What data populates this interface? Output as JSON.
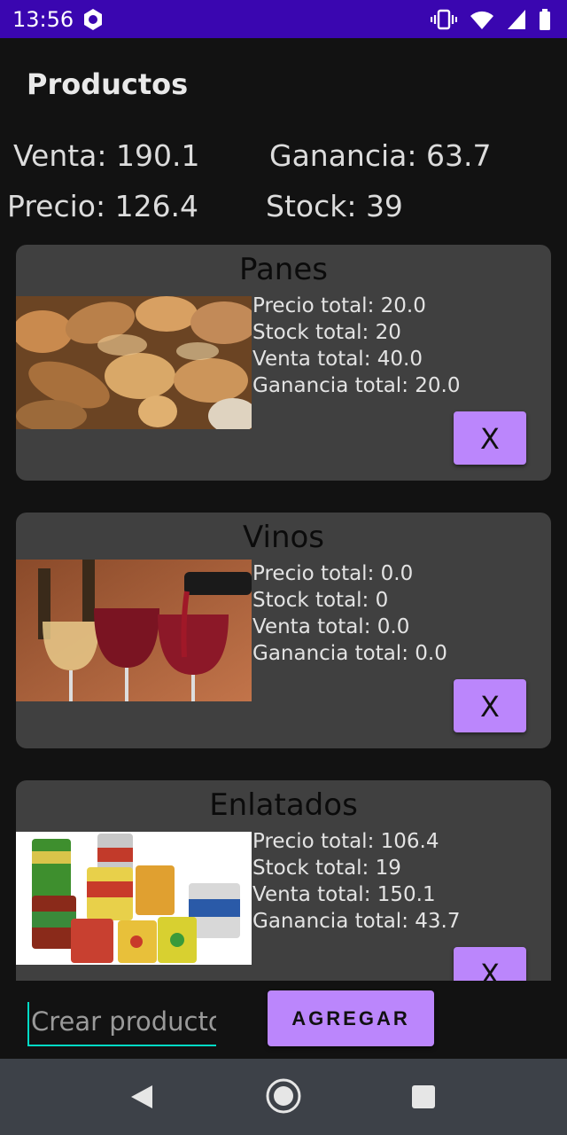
{
  "status_bar": {
    "time": "13:56",
    "icons": [
      "settings-icon",
      "vibrate-icon",
      "wifi-icon",
      "signal-icon",
      "battery-icon"
    ]
  },
  "app_bar": {
    "title": "Productos"
  },
  "summary": {
    "venta": "Venta: 190.1",
    "ganancia": "Ganancia: 63.7",
    "precio": "Precio: 126.4",
    "stock": "Stock: 39"
  },
  "products": [
    {
      "name": "Panes",
      "precio": "Precio total: 20.0",
      "stock": "Stock total: 20",
      "venta": "Venta total: 40.0",
      "ganancia": "Ganancia total: 20.0",
      "delete_label": "X"
    },
    {
      "name": "Vinos",
      "precio": "Precio total: 0.0",
      "stock": "Stock total: 0",
      "venta": "Venta total: 0.0",
      "ganancia": "Ganancia total: 0.0",
      "delete_label": "X"
    },
    {
      "name": "Enlatados",
      "precio": "Precio total: 106.4",
      "stock": "Stock total: 19",
      "venta": "Venta total: 150.1",
      "ganancia": "Ganancia total: 43.7",
      "delete_label": "X"
    }
  ],
  "bottom": {
    "input_placeholder": "Crear producto",
    "input_value": "",
    "add_label": "AGREGAR"
  },
  "nav_bar": {
    "icons": [
      "back-icon",
      "home-icon",
      "recents-icon"
    ]
  },
  "colors": {
    "status_bar": "#3a06b0",
    "background": "#121212",
    "card": "#404040",
    "accent": "#bb86fc",
    "input_line": "#03dac5",
    "nav_bar": "#3d4148"
  }
}
